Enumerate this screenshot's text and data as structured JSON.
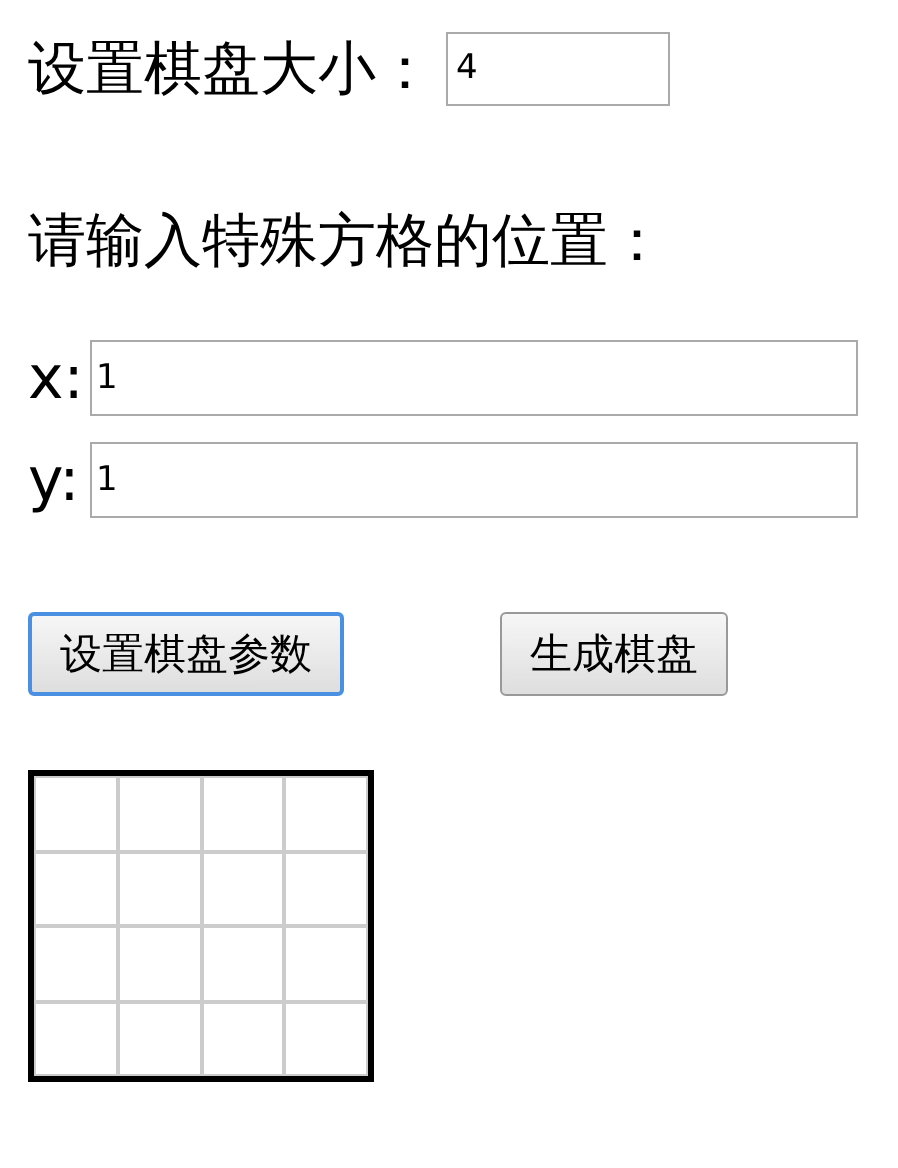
{
  "size_label": "设置棋盘大小：",
  "size_input": {
    "value": "4"
  },
  "position_prompt": "请输入特殊方格的位置：",
  "coords": [
    {
      "label": "x:",
      "value": "1"
    },
    {
      "label": "y:",
      "value": "1"
    }
  ],
  "buttons": [
    {
      "label": "设置棋盘参数",
      "focused": true
    },
    {
      "label": "生成棋盘",
      "focused": false
    }
  ],
  "board": {
    "rows": [
      [
        {
          "filled": false
        },
        {
          "filled": false
        },
        {
          "filled": false
        },
        {
          "filled": false
        }
      ],
      [
        {
          "filled": false
        },
        {
          "filled": false
        },
        {
          "filled": false
        },
        {
          "filled": false
        }
      ],
      [
        {
          "filled": false
        },
        {
          "filled": false
        },
        {
          "filled": false
        },
        {
          "filled": false
        }
      ],
      [
        {
          "filled": false
        },
        {
          "filled": false
        },
        {
          "filled": false
        },
        {
          "filled": false
        }
      ]
    ]
  }
}
